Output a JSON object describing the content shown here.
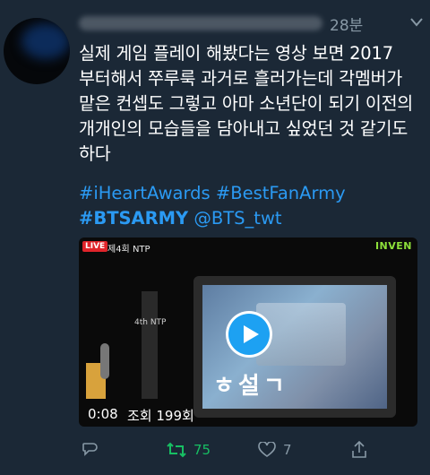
{
  "tweet": {
    "timestamp": "28분",
    "body": "실제 게임 플레이 해봤다는 영상 보면 2017\n부터해서 쭈루룩 과거로 흘러가는데 각멤버가\n맡은 컨셉도 그렇고 아마 소년단이 되기 이전의\n개개인의 모습들을 담아내고 싶었던 것 같기도\n하다",
    "hashtags": {
      "tag1": "#iHeartAwards",
      "tag2": "#BestFanArmy",
      "tag3": "#BTSARMY",
      "mention": "@BTS_twt"
    }
  },
  "media": {
    "live_label": "LIVE",
    "channel_label": "제4회 NTP",
    "brand_label": "INVEN",
    "stage_sign": "4th NTP",
    "screen_text": "ㅎ설ㄱ",
    "duration": "0:08",
    "views": "조회 199회"
  },
  "actions": {
    "retweet_count": "75",
    "like_count": "7"
  },
  "colors": {
    "background": "#1b2836",
    "link": "#2b9af3",
    "retweet": "#17bf63",
    "muted": "#8899a6",
    "play": "#1da1f2"
  },
  "icons": {
    "reply": "reply-icon",
    "retweet": "retweet-icon",
    "like": "heart-icon",
    "share": "share-icon",
    "play": "play-icon",
    "caret": "chevron-down-icon"
  }
}
